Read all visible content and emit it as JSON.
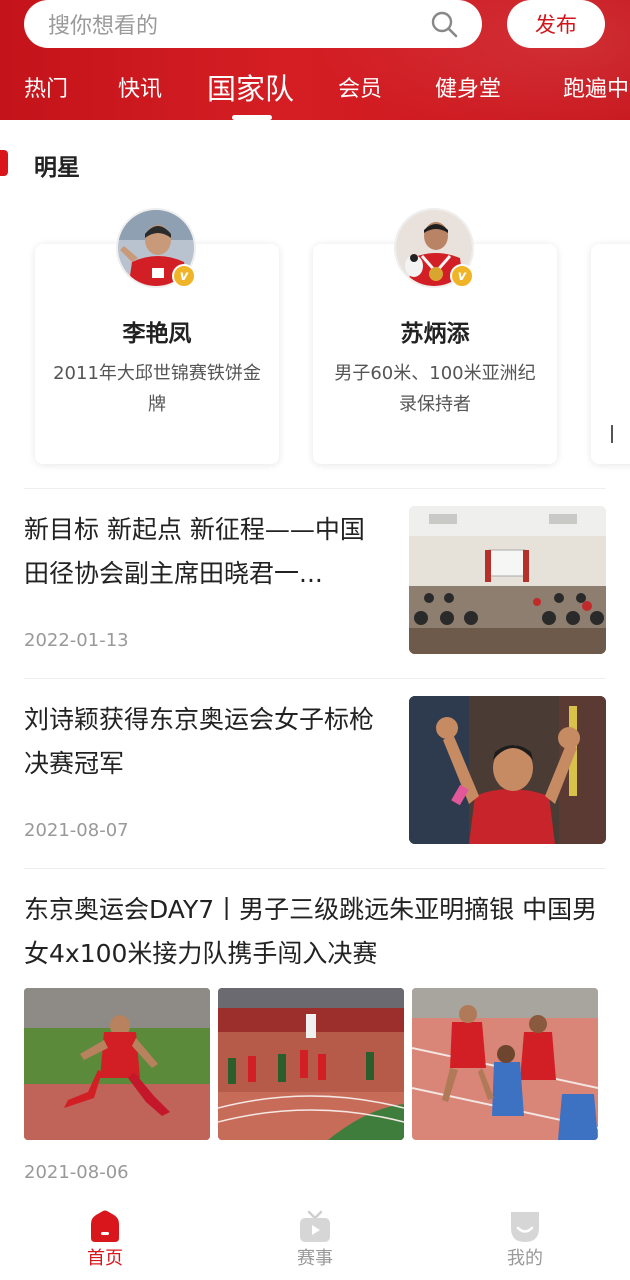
{
  "search": {
    "placeholder": "搜你想看的"
  },
  "header": {
    "publish_label": "发布"
  },
  "tabs": [
    {
      "label": "热门"
    },
    {
      "label": "快讯"
    },
    {
      "label": "国家队",
      "active": true
    },
    {
      "label": "会员"
    },
    {
      "label": "健身堂"
    },
    {
      "label": "跑遍中"
    }
  ],
  "section": {
    "title": "明星"
  },
  "stars": [
    {
      "name": "李艳凤",
      "desc": "2011年大邱世锦赛铁饼金牌"
    },
    {
      "name": "苏炳添",
      "desc": "男子60米、100米亚洲纪录保持者"
    }
  ],
  "news": [
    {
      "title": "新目标 新起点 新征程——中国田径协会副主席田晓君一...",
      "date": "2022-01-13"
    },
    {
      "title": "刘诗颖获得东京奥运会女子标枪决赛冠军",
      "date": "2021-08-07"
    },
    {
      "title": "东京奥运会DAY7丨男子三级跳远朱亚明摘银 中国男女4x100米接力队携手闯入决赛",
      "date": "2021-08-06"
    }
  ],
  "nav": [
    {
      "label": "首页",
      "icon": "home-icon",
      "active": true
    },
    {
      "label": "赛事",
      "icon": "tv-icon"
    },
    {
      "label": "我的",
      "icon": "profile-icon"
    }
  ],
  "colors": {
    "brand": "#d0161c",
    "badge": "#f0b429",
    "muted": "#999999"
  }
}
